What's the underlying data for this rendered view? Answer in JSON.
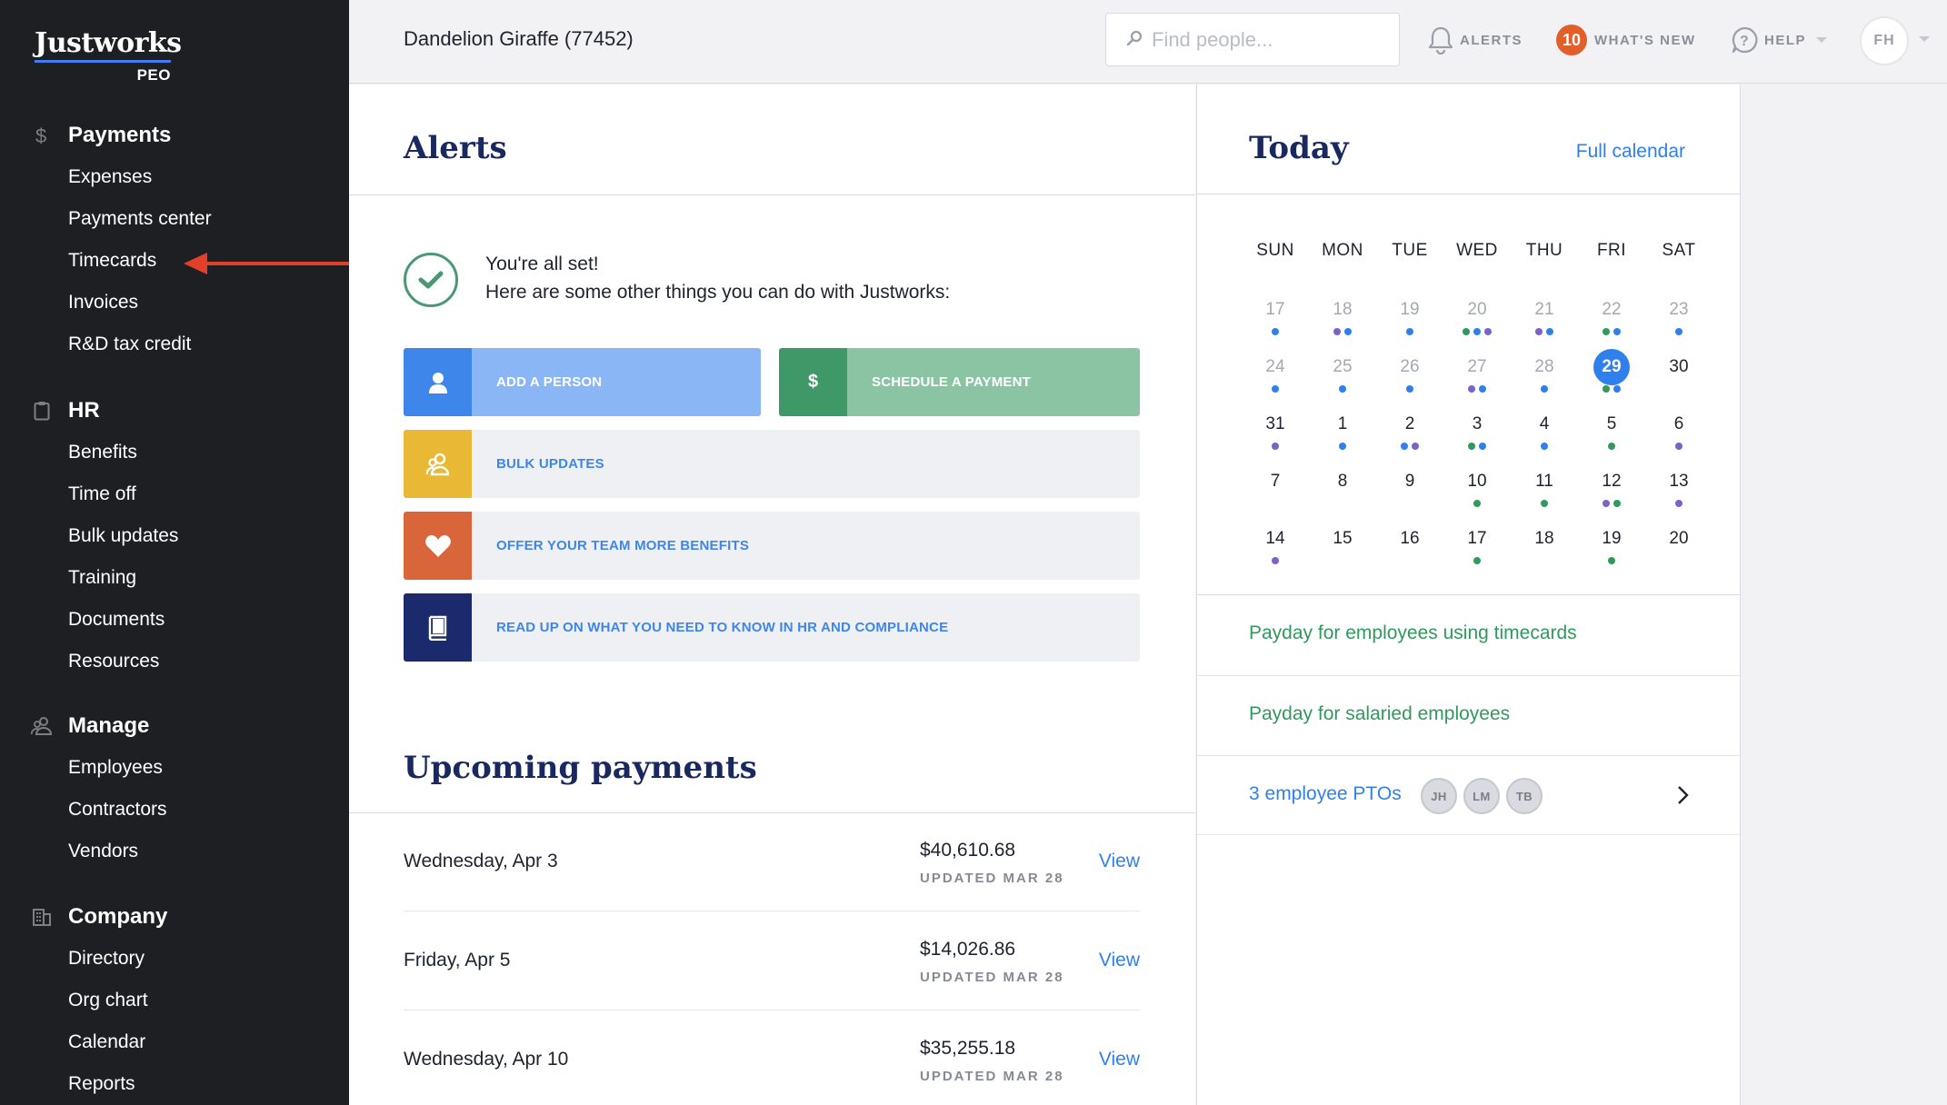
{
  "sidebar": {
    "logo": "Justworks",
    "logo_sub": "PEO",
    "sections": [
      {
        "icon": "dollar-icon",
        "label": "Payments",
        "items": [
          "Expenses",
          "Payments center",
          "Timecards",
          "Invoices",
          "R&D tax credit"
        ]
      },
      {
        "icon": "clipboard-icon",
        "label": "HR",
        "items": [
          "Benefits",
          "Time off",
          "Bulk updates",
          "Training",
          "Documents",
          "Resources"
        ]
      },
      {
        "icon": "people-icon",
        "label": "Manage",
        "items": [
          "Employees",
          "Contractors",
          "Vendors"
        ]
      },
      {
        "icon": "building-icon",
        "label": "Company",
        "items": [
          "Directory",
          "Org chart",
          "Calendar",
          "Reports"
        ]
      }
    ]
  },
  "topbar": {
    "company": "Dandelion Giraffe (77452)",
    "search_placeholder": "Find people...",
    "alerts_label": "ALERTS",
    "whats_new_count": "10",
    "whats_new_label": "WHAT'S NEW",
    "help_label": "HELP",
    "user_initials": "FH"
  },
  "alerts": {
    "title": "Alerts",
    "status_line1": "You're all set!",
    "status_line2": "Here are some other things you can do with Justworks:",
    "actions": {
      "add_person": "ADD A PERSON",
      "schedule_payment": "SCHEDULE A PAYMENT",
      "schedule_icon": "$",
      "bulk_updates": "BULK UPDATES",
      "benefits": "OFFER YOUR TEAM MORE BENEFITS",
      "read_up": "READ UP ON WHAT YOU NEED TO KNOW IN HR AND COMPLIANCE"
    }
  },
  "payments": {
    "title": "Upcoming payments",
    "rows": [
      {
        "date": "Wednesday, Apr 3",
        "amount": "$40,610.68",
        "updated": "UPDATED MAR 28",
        "action": "View"
      },
      {
        "date": "Friday, Apr 5",
        "amount": "$14,026.86",
        "updated": "UPDATED MAR 28",
        "action": "View"
      },
      {
        "date": "Wednesday, Apr 10",
        "amount": "$35,255.18",
        "updated": "UPDATED MAR 28",
        "action": "View"
      }
    ]
  },
  "today": {
    "title": "Today",
    "full_calendar": "Full calendar",
    "days_of_week": [
      "SUN",
      "MON",
      "TUE",
      "WED",
      "THU",
      "FRI",
      "SAT"
    ],
    "colors": {
      "blue": "#2f80ed",
      "purple": "#7b61c9",
      "green": "#2f9a5c"
    },
    "weeks": [
      [
        {
          "n": "17",
          "s": "past",
          "d": [
            "blue"
          ]
        },
        {
          "n": "18",
          "s": "past",
          "d": [
            "purple",
            "blue"
          ]
        },
        {
          "n": "19",
          "s": "past",
          "d": [
            "blue"
          ]
        },
        {
          "n": "20",
          "s": "past",
          "d": [
            "green",
            "blue",
            "purple"
          ]
        },
        {
          "n": "21",
          "s": "past",
          "d": [
            "purple",
            "blue"
          ]
        },
        {
          "n": "22",
          "s": "past",
          "d": [
            "green",
            "blue"
          ]
        },
        {
          "n": "23",
          "s": "past",
          "d": [
            "blue"
          ]
        }
      ],
      [
        {
          "n": "24",
          "s": "past",
          "d": [
            "blue"
          ]
        },
        {
          "n": "25",
          "s": "past",
          "d": [
            "blue"
          ]
        },
        {
          "n": "26",
          "s": "past",
          "d": [
            "blue"
          ]
        },
        {
          "n": "27",
          "s": "past",
          "d": [
            "purple",
            "blue"
          ]
        },
        {
          "n": "28",
          "s": "past",
          "d": [
            "blue"
          ]
        },
        {
          "n": "29",
          "s": "today",
          "d": [
            "green",
            "blue"
          ]
        },
        {
          "n": "30",
          "s": "cur",
          "d": []
        }
      ],
      [
        {
          "n": "31",
          "s": "cur",
          "d": [
            "purple"
          ]
        },
        {
          "n": "1",
          "s": "cur",
          "d": [
            "blue"
          ]
        },
        {
          "n": "2",
          "s": "cur",
          "d": [
            "blue",
            "purple"
          ]
        },
        {
          "n": "3",
          "s": "cur",
          "d": [
            "green",
            "blue"
          ]
        },
        {
          "n": "4",
          "s": "cur",
          "d": [
            "blue"
          ]
        },
        {
          "n": "5",
          "s": "cur",
          "d": [
            "green"
          ]
        },
        {
          "n": "6",
          "s": "cur",
          "d": [
            "purple"
          ]
        }
      ],
      [
        {
          "n": "7",
          "s": "cur",
          "d": []
        },
        {
          "n": "8",
          "s": "cur",
          "d": []
        },
        {
          "n": "9",
          "s": "cur",
          "d": []
        },
        {
          "n": "10",
          "s": "cur",
          "d": [
            "green"
          ]
        },
        {
          "n": "11",
          "s": "cur",
          "d": [
            "green"
          ]
        },
        {
          "n": "12",
          "s": "cur",
          "d": [
            "purple",
            "green"
          ]
        },
        {
          "n": "13",
          "s": "cur",
          "d": [
            "purple"
          ]
        }
      ],
      [
        {
          "n": "14",
          "s": "cur",
          "d": [
            "purple"
          ]
        },
        {
          "n": "15",
          "s": "cur",
          "d": []
        },
        {
          "n": "16",
          "s": "cur",
          "d": []
        },
        {
          "n": "17",
          "s": "cur",
          "d": [
            "green"
          ]
        },
        {
          "n": "18",
          "s": "cur",
          "d": []
        },
        {
          "n": "19",
          "s": "cur",
          "d": [
            "green"
          ]
        },
        {
          "n": "20",
          "s": "cur",
          "d": []
        }
      ]
    ],
    "events": [
      {
        "text": "Payday for employees using timecards",
        "color": "#2f9a5c"
      },
      {
        "text": "Payday for salaried employees",
        "color": "#2f9a5c"
      },
      {
        "text": "3 employee PTOs",
        "color": "#2f80ed",
        "avatars": [
          "JH",
          "LM",
          "TB"
        ]
      }
    ]
  }
}
